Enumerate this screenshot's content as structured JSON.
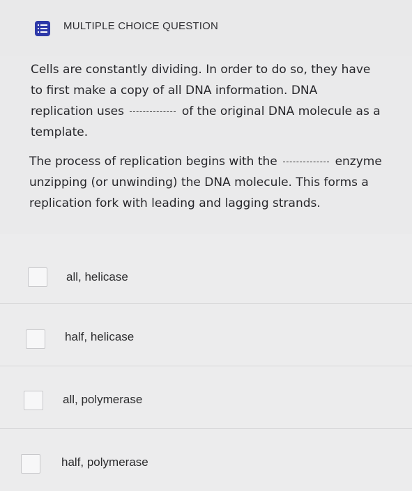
{
  "header": {
    "type_icon": "list-icon",
    "type_label": "MULTIPLE CHOICE QUESTION"
  },
  "question": {
    "para1_part1": "Cells are constantly dividing. In order to do so, they have to first make a copy of all DNA information. DNA replication uses",
    "para1_part2": "of the original DNA molecule as a template.",
    "para2_part1": "The process of replication begins with the",
    "para2_part2": "enzyme unzipping (or unwinding) the DNA molecule. This forms a replication fork with leading and lagging strands."
  },
  "options": [
    {
      "label": "all, helicase",
      "checked": false
    },
    {
      "label": "half, helicase",
      "checked": false
    },
    {
      "label": "all, polymerase",
      "checked": false
    },
    {
      "label": "half, polymerase",
      "checked": false
    }
  ],
  "colors": {
    "icon_bg": "#2d38a8",
    "page_bg": "#ededee"
  }
}
